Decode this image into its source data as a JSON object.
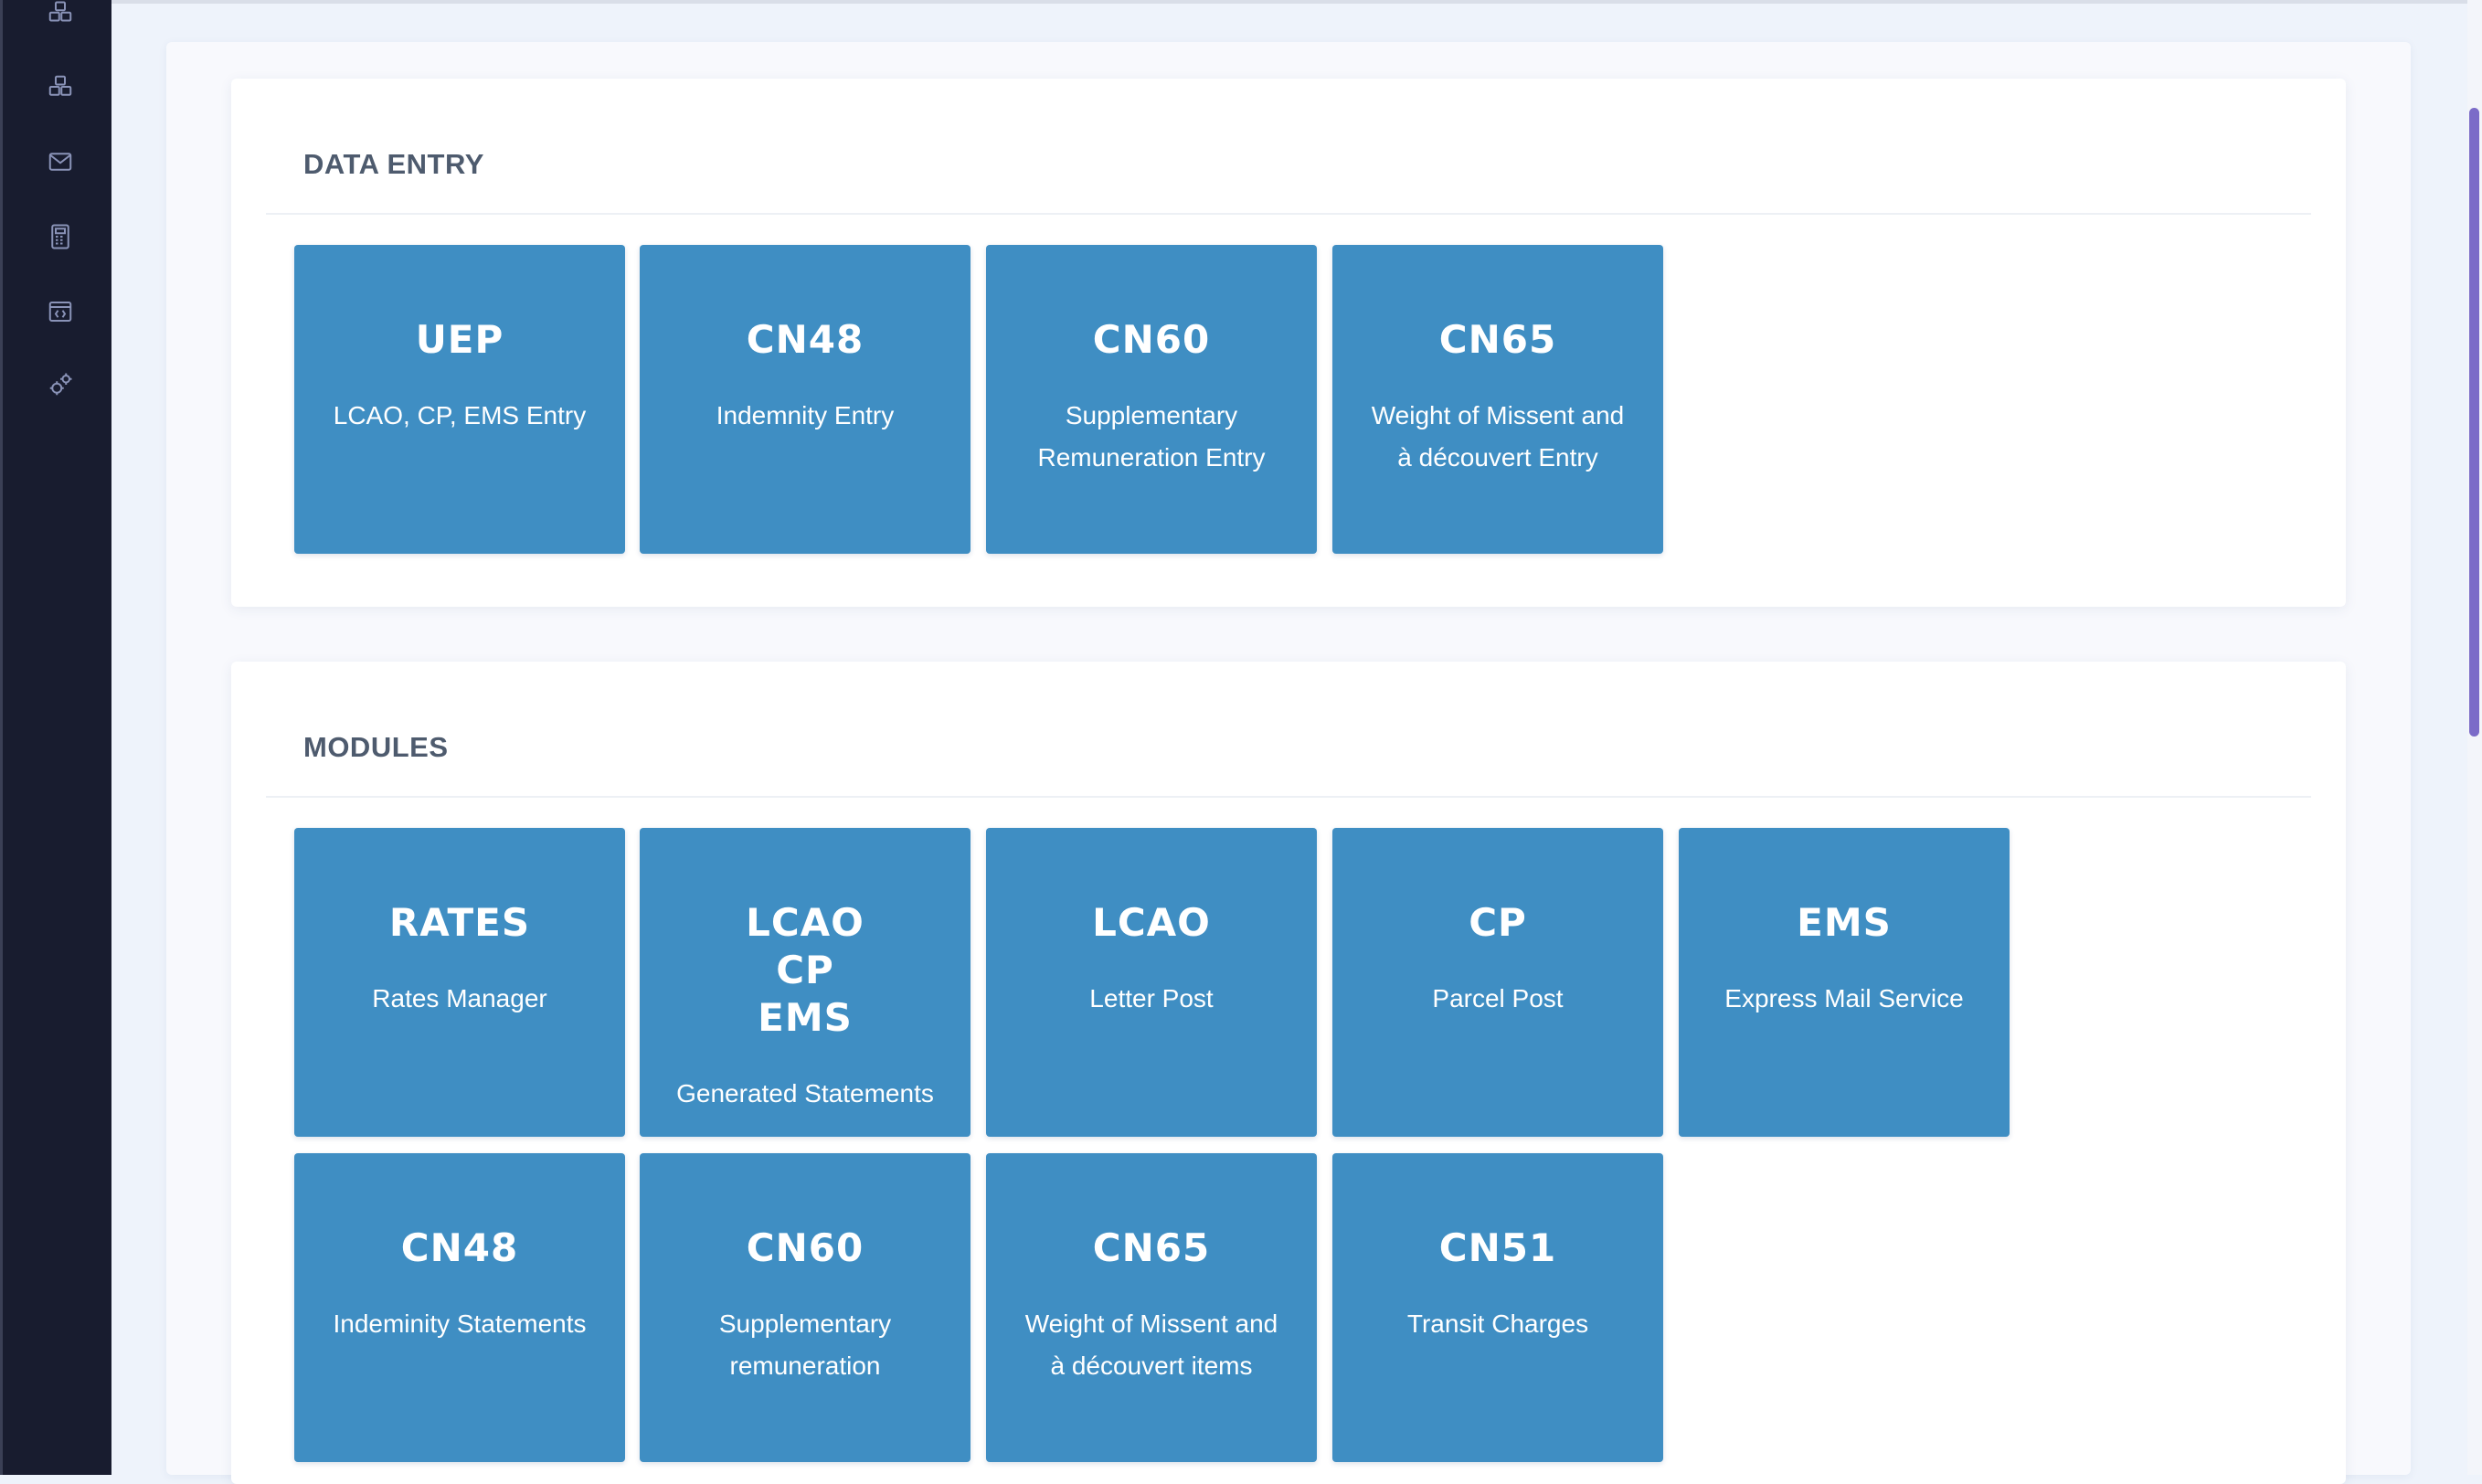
{
  "sidebar": {
    "icons": [
      "boxes-icon",
      "boxes-icon",
      "mail-icon",
      "calculator-icon",
      "code-window-icon",
      "gears-icon"
    ]
  },
  "data_entry": {
    "title": "DATA ENTRY",
    "tiles": [
      {
        "code": "UEP",
        "desc": "LCAO, CP, EMS Entry"
      },
      {
        "code": "CN48",
        "desc": "Indemnity Entry"
      },
      {
        "code": "CN60",
        "desc": "Supplementary Remuneration Entry"
      },
      {
        "code": "CN65",
        "desc": "Weight of Missent and à découvert Entry"
      }
    ]
  },
  "modules": {
    "title": "MODULES",
    "tiles": [
      {
        "code": "RATES",
        "desc": "Rates Manager"
      },
      {
        "code": "LCAO\nCP\nEMS",
        "desc": "Generated Statements"
      },
      {
        "code": "LCAO",
        "desc": "Letter Post"
      },
      {
        "code": "CP",
        "desc": "Parcel Post"
      },
      {
        "code": "EMS",
        "desc": "Express Mail Service"
      },
      {
        "code": "CN48",
        "desc": "Indeminity Statements"
      },
      {
        "code": "CN60",
        "desc": "Supplementary remuneration"
      },
      {
        "code": "CN65",
        "desc": "Weight of Missent and à découvert items"
      },
      {
        "code": "CN51",
        "desc": "Transit Charges"
      }
    ]
  },
  "colors": {
    "tile": "#3f8ec3",
    "sidebar": "#181c2f",
    "title": "#4e5b6e",
    "scroll_thumb": "#7b6bc8"
  }
}
